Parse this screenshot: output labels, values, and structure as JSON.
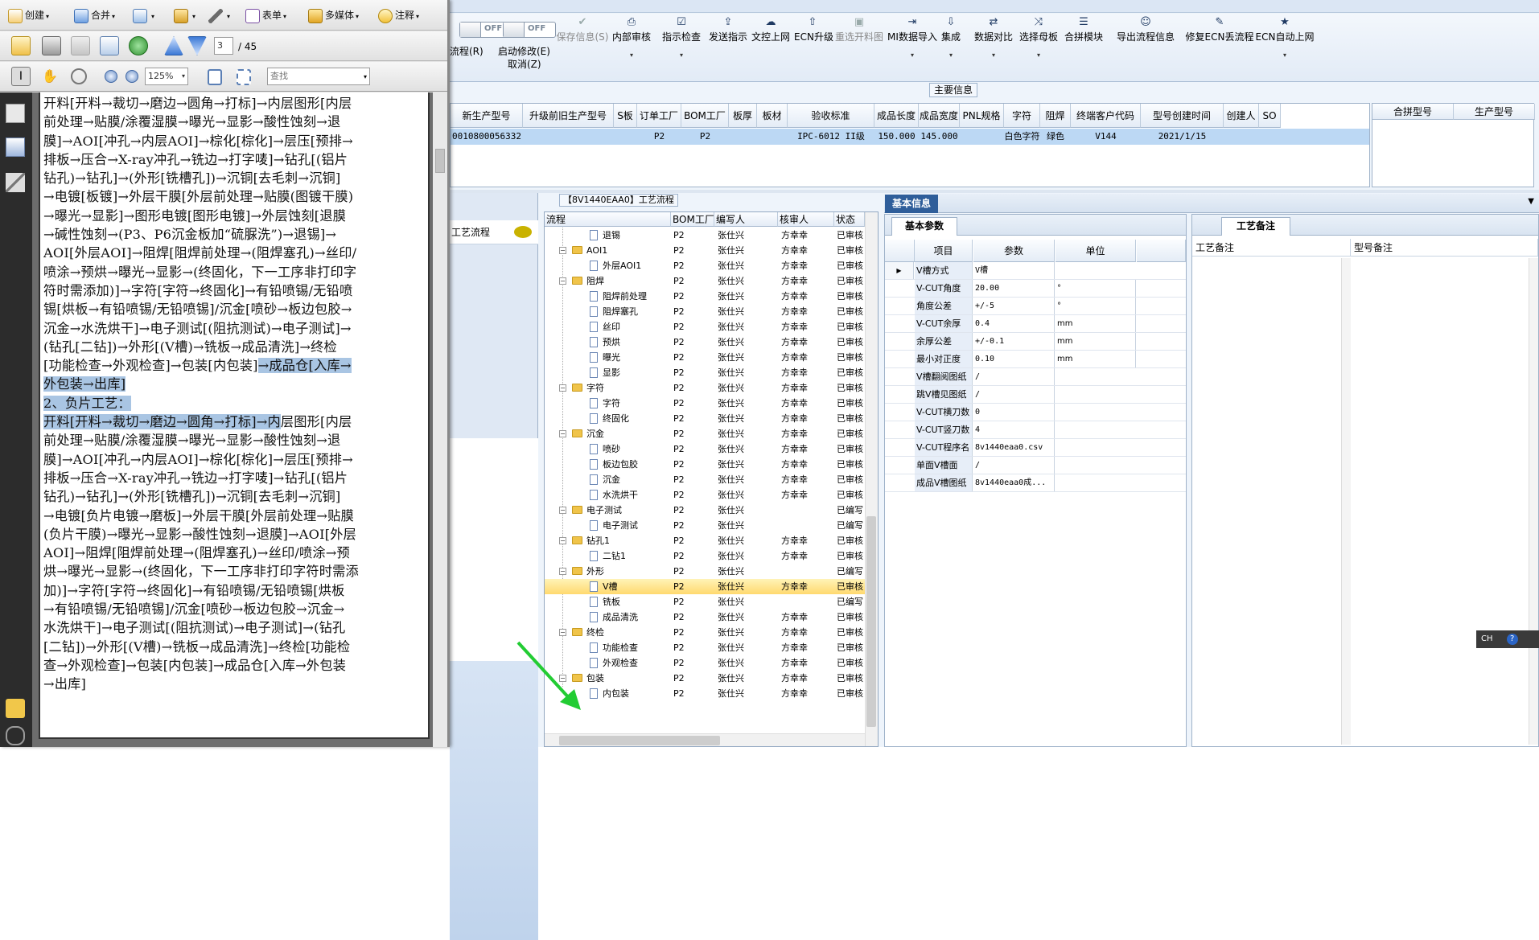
{
  "pdf": {
    "toolbar1": {
      "create": "创建",
      "combine": "合并",
      "forms": "表单",
      "multimedia": "多媒体",
      "comment": "注释"
    },
    "toolbar2": {
      "page_current": "3",
      "page_total": "/ 45"
    },
    "toolbar3": {
      "zoom": "125%",
      "find_placeholder": "查找"
    },
    "lines": [
      {
        "text": "开料[开料→裁切→磨边→圆角→打标]→内层图形[内层"
      },
      {
        "text": "前处理→贴膜/涂覆湿膜→曝光→显影→酸性蚀刻→退"
      },
      {
        "text": "膜]→AOI[冲孔→内层AOI]→棕化[棕化]→层压[预排→"
      },
      {
        "text": "排板→压合→X-ray冲孔→铣边→打字唛]→钻孔[(铝片"
      },
      {
        "text": "钻孔)→钻孔]→(外形[铣槽孔])→沉铜[去毛刺→沉铜]"
      },
      {
        "text": "→电镀[板镀]→外层干膜[外层前处理→贴膜(图镀干膜)"
      },
      {
        "text": "→曝光→显影]→图形电镀[图形电镀]→外层蚀刻[退膜"
      },
      {
        "text": "→碱性蚀刻→(P3、P6沉金板加“硫脲洗”)→退锡]→"
      },
      {
        "text": "AOI[外层AOI]→阻焊[阻焊前处理→(阻焊塞孔)→丝印/"
      },
      {
        "text": "喷涂→预烘→曝光→显影→(终固化，下一工序非打印字"
      },
      {
        "text": "符时需添加)]→字符[字符→终固化]→有铅喷锡/无铅喷"
      },
      {
        "text": "锡[烘板→有铅喷锡/无铅喷锡]/沉金[喷砂→板边包胶→"
      },
      {
        "text": "沉金→水洗烘干]→电子测试[(阻抗测试)→电子测试]→"
      },
      {
        "text": "(钻孔[二钻])→外形[(V槽)→铣板→成品清洗]→终检"
      },
      {
        "text": "[功能检查→外观检查]→包装[内包装]",
        "hl": "→成品仓[入库→"
      },
      {
        "hl": "外包装→出库]"
      },
      {
        "hl": "2、负片工艺："
      },
      {
        "hl": "开料[开料→裁切→磨边→圆角→打标]→内",
        "text": "层图形[内层"
      },
      {
        "text": "前处理→贴膜/涂覆湿膜→曝光→显影→酸性蚀刻→退"
      },
      {
        "text": "膜]→AOI[冲孔→内层AOI]→棕化[棕化]→层压[预排→"
      },
      {
        "text": "排板→压合→X-ray冲孔→铣边→打字唛]→钻孔[(铝片"
      },
      {
        "text": "钻孔)→钻孔]→(外形[铣槽孔])→沉铜[去毛刺→沉铜]"
      },
      {
        "text": "→电镀[负片电镀→磨板]→外层干膜[外层前处理→贴膜"
      },
      {
        "text": "(负片干膜)→曝光→显影→酸性蚀刻→退膜]→AOI[外层"
      },
      {
        "text": "AOI]→阻焊[阻焊前处理→(阻焊塞孔)→丝印/喷涂→预"
      },
      {
        "text": "烘→曝光→显影→(终固化，下一工序非打印字符时需添"
      },
      {
        "text": "加)]→字符[字符→终固化]→有铅喷锡/无铅喷锡[烘板"
      },
      {
        "text": "→有铅喷锡/无铅喷锡]/沉金[喷砂→板边包胶→沉金→"
      },
      {
        "text": "水洗烘干]→电子测试[(阻抗测试)→电子测试]→(钻孔"
      },
      {
        "text": "[二钻])→外形[(V槽)→铣板→成品清洗]→终检[功能检"
      },
      {
        "text": "查→外观检查]→包装[内包装]→成品仓[入库→外包装"
      },
      {
        "text": "→出库]"
      }
    ]
  },
  "erp": {
    "toggles": [
      {
        "text": "OFF",
        "label": "流程(R)"
      },
      {
        "text": "OFF",
        "label": "启动修改(E)"
      }
    ],
    "cancel": "取消(Z)",
    "ribbon": [
      {
        "icon": "check-icon",
        "glyph": "✔",
        "label": "保存信息(S)",
        "disabled": true
      },
      {
        "icon": "printer-icon",
        "glyph": "⎙",
        "label": "内部审核",
        "dropdown": "▾"
      },
      {
        "icon": "checklist-icon",
        "glyph": "☑",
        "label": "指示检查",
        "dropdown": "▾"
      },
      {
        "icon": "upload-icon",
        "glyph": "⇪",
        "label": "发送指示"
      },
      {
        "icon": "cloud-upload-icon",
        "glyph": "☁",
        "label": "文控上网"
      },
      {
        "icon": "upgrade-icon",
        "glyph": "⇧",
        "label": "ECN升级"
      },
      {
        "icon": "image-icon",
        "glyph": "▣",
        "label": "重选开料图",
        "disabled": true
      },
      {
        "icon": "import-icon",
        "glyph": "⇥",
        "label": "MI数据导入",
        "dropdown": "▾"
      },
      {
        "icon": "download-icon",
        "glyph": "⇩",
        "label": "集成",
        "dropdown": "▾"
      },
      {
        "icon": "compare-icon",
        "glyph": "⇄",
        "label": "数据对比",
        "dropdown": "▾"
      },
      {
        "icon": "shuffle-icon",
        "glyph": "⤨",
        "label": "选择母板",
        "dropdown": "▾"
      },
      {
        "icon": "list-icon",
        "glyph": "☰",
        "label": "合拼模块"
      },
      {
        "icon": "smile-icon",
        "glyph": "☺",
        "label": "导出流程信息"
      },
      {
        "icon": "wrench-icon",
        "glyph": "✎",
        "label": "修复ECN丢流程"
      },
      {
        "icon": "star-icon",
        "glyph": "★",
        "label": "ECN自动上网",
        "dropdown": "▾"
      }
    ],
    "main_info_title": "主要信息",
    "grid1": {
      "headers": [
        "新生产型号",
        "升级前旧生产型号",
        "S板",
        "订单工厂",
        "BOM工厂",
        "板厚",
        "板材",
        "验收标准",
        "成品长度",
        "成品宽度",
        "PNL规格",
        "字符",
        "阻焊",
        "终端客户代码",
        "型号创建时间",
        "创建人",
        "SO"
      ],
      "row": [
        "0010800056332",
        "",
        "",
        "P2",
        "P2",
        "",
        "",
        "IPC-6012 II级",
        "150.000",
        "145.000",
        "",
        "白色字符",
        "绿色",
        "V144",
        "2021/1/15",
        "",
        ""
      ]
    },
    "grid2": {
      "headers": [
        "合拼型号",
        "生产型号"
      ]
    },
    "left_tab": "工艺流程",
    "process_title": "【8V1440EAA0】工艺流程",
    "tree": {
      "headers": [
        "流程",
        "BOM工厂",
        "编写人",
        "核审人",
        "状态"
      ],
      "rows": [
        {
          "lvl": 2,
          "type": "doc",
          "name": "退锡",
          "bom": "P2",
          "author": "张仕兴",
          "reviewer": "方幸幸",
          "status": "已审核"
        },
        {
          "lvl": 1,
          "type": "folder",
          "name": "AOI1",
          "bom": "P2",
          "author": "张仕兴",
          "reviewer": "方幸幸",
          "status": "已审核"
        },
        {
          "lvl": 2,
          "type": "doc",
          "name": "外层AOI1",
          "bom": "P2",
          "author": "张仕兴",
          "reviewer": "方幸幸",
          "status": "已审核"
        },
        {
          "lvl": 1,
          "type": "folder",
          "name": "阻焊",
          "bom": "P2",
          "author": "张仕兴",
          "reviewer": "方幸幸",
          "status": "已审核"
        },
        {
          "lvl": 2,
          "type": "doc",
          "name": "阻焊前处理",
          "bom": "P2",
          "author": "张仕兴",
          "reviewer": "方幸幸",
          "status": "已审核"
        },
        {
          "lvl": 2,
          "type": "doc",
          "name": "阻焊塞孔",
          "bom": "P2",
          "author": "张仕兴",
          "reviewer": "方幸幸",
          "status": "已审核"
        },
        {
          "lvl": 2,
          "type": "doc",
          "name": "丝印",
          "bom": "P2",
          "author": "张仕兴",
          "reviewer": "方幸幸",
          "status": "已审核"
        },
        {
          "lvl": 2,
          "type": "doc",
          "name": "预烘",
          "bom": "P2",
          "author": "张仕兴",
          "reviewer": "方幸幸",
          "status": "已审核"
        },
        {
          "lvl": 2,
          "type": "doc",
          "name": "曝光",
          "bom": "P2",
          "author": "张仕兴",
          "reviewer": "方幸幸",
          "status": "已审核"
        },
        {
          "lvl": 2,
          "type": "doc",
          "name": "显影",
          "bom": "P2",
          "author": "张仕兴",
          "reviewer": "方幸幸",
          "status": "已审核"
        },
        {
          "lvl": 1,
          "type": "folder",
          "name": "字符",
          "bom": "P2",
          "author": "张仕兴",
          "reviewer": "方幸幸",
          "status": "已审核"
        },
        {
          "lvl": 2,
          "type": "doc",
          "name": "字符",
          "bom": "P2",
          "author": "张仕兴",
          "reviewer": "方幸幸",
          "status": "已审核"
        },
        {
          "lvl": 2,
          "type": "doc",
          "name": "终固化",
          "bom": "P2",
          "author": "张仕兴",
          "reviewer": "方幸幸",
          "status": "已审核"
        },
        {
          "lvl": 1,
          "type": "folder",
          "name": "沉金",
          "bom": "P2",
          "author": "张仕兴",
          "reviewer": "方幸幸",
          "status": "已审核"
        },
        {
          "lvl": 2,
          "type": "doc",
          "name": "喷砂",
          "bom": "P2",
          "author": "张仕兴",
          "reviewer": "方幸幸",
          "status": "已审核"
        },
        {
          "lvl": 2,
          "type": "doc",
          "name": "板边包胶",
          "bom": "P2",
          "author": "张仕兴",
          "reviewer": "方幸幸",
          "status": "已审核"
        },
        {
          "lvl": 2,
          "type": "doc",
          "name": "沉金",
          "bom": "P2",
          "author": "张仕兴",
          "reviewer": "方幸幸",
          "status": "已审核"
        },
        {
          "lvl": 2,
          "type": "doc",
          "name": "水洗烘干",
          "bom": "P2",
          "author": "张仕兴",
          "reviewer": "方幸幸",
          "status": "已审核"
        },
        {
          "lvl": 1,
          "type": "folder",
          "name": "电子测试",
          "bom": "P2",
          "author": "张仕兴",
          "reviewer": "",
          "status": "已编写"
        },
        {
          "lvl": 2,
          "type": "doc",
          "name": "电子测试",
          "bom": "P2",
          "author": "张仕兴",
          "reviewer": "",
          "status": "已编写"
        },
        {
          "lvl": 1,
          "type": "folder",
          "name": "钻孔1",
          "bom": "P2",
          "author": "张仕兴",
          "reviewer": "方幸幸",
          "status": "已审核"
        },
        {
          "lvl": 2,
          "type": "doc",
          "name": "二钻1",
          "bom": "P2",
          "author": "张仕兴",
          "reviewer": "方幸幸",
          "status": "已审核"
        },
        {
          "lvl": 1,
          "type": "folder",
          "name": "外形",
          "bom": "P2",
          "author": "张仕兴",
          "reviewer": "",
          "status": "已编写"
        },
        {
          "lvl": 2,
          "type": "doc",
          "name": "V槽",
          "bom": "P2",
          "author": "张仕兴",
          "reviewer": "方幸幸",
          "status": "已审核",
          "selected": true
        },
        {
          "lvl": 2,
          "type": "doc",
          "name": "铣板",
          "bom": "P2",
          "author": "张仕兴",
          "reviewer": "",
          "status": "已编写"
        },
        {
          "lvl": 2,
          "type": "doc",
          "name": "成品清洗",
          "bom": "P2",
          "author": "张仕兴",
          "reviewer": "方幸幸",
          "status": "已审核"
        },
        {
          "lvl": 1,
          "type": "folder",
          "name": "终检",
          "bom": "P2",
          "author": "张仕兴",
          "reviewer": "方幸幸",
          "status": "已审核"
        },
        {
          "lvl": 2,
          "type": "doc",
          "name": "功能检查",
          "bom": "P2",
          "author": "张仕兴",
          "reviewer": "方幸幸",
          "status": "已审核"
        },
        {
          "lvl": 2,
          "type": "doc",
          "name": "外观检查",
          "bom": "P2",
          "author": "张仕兴",
          "reviewer": "方幸幸",
          "status": "已审核"
        },
        {
          "lvl": 1,
          "type": "folder",
          "name": "包装",
          "bom": "P2",
          "author": "张仕兴",
          "reviewer": "方幸幸",
          "status": "已审核"
        },
        {
          "lvl": 2,
          "type": "doc",
          "name": "内包装",
          "bom": "P2",
          "author": "张仕兴",
          "reviewer": "方幸幸",
          "status": "已审核"
        }
      ]
    },
    "basic_info_tab": "基本信息",
    "basic_params": {
      "tab": "基本参数",
      "headers": [
        "项目",
        "参数",
        "单位"
      ],
      "rows": [
        {
          "item": "V槽方式",
          "value": "V槽",
          "unit": "",
          "current": true
        },
        {
          "item": "V-CUT角度",
          "value": "20.00",
          "unit": "°"
        },
        {
          "item": "角度公差",
          "value": "+/-5",
          "unit": "°"
        },
        {
          "item": "V-CUT余厚",
          "value": "0.4",
          "unit": "mm"
        },
        {
          "item": "余厚公差",
          "value": "+/-0.1",
          "unit": "mm"
        },
        {
          "item": "最小对正度",
          "value": "0.10",
          "unit": "mm"
        },
        {
          "item": "V槽翻阅图纸",
          "value": "/",
          "unit": ""
        },
        {
          "item": "跳V槽见图纸",
          "value": "/",
          "unit": ""
        },
        {
          "item": "V-CUT横刀数",
          "value": "0",
          "unit": ""
        },
        {
          "item": "V-CUT竖刀数",
          "value": "4",
          "unit": ""
        },
        {
          "item": "V-CUT程序名",
          "value": "8v1440eaa0.csv",
          "unit": ""
        },
        {
          "item": "单面V槽面",
          "value": "/",
          "unit": ""
        },
        {
          "item": "成品V槽图纸",
          "value": "8v1440eaa0成...",
          "unit": ""
        }
      ]
    },
    "process_notes": {
      "tab": "工艺备注",
      "col1": "工艺备注",
      "col2": "型号备注"
    },
    "ime": "CH"
  },
  "colors": {
    "highlight": "#a9c5e3",
    "selected_row": "#ffd96e",
    "arrow": "#22cc33"
  }
}
